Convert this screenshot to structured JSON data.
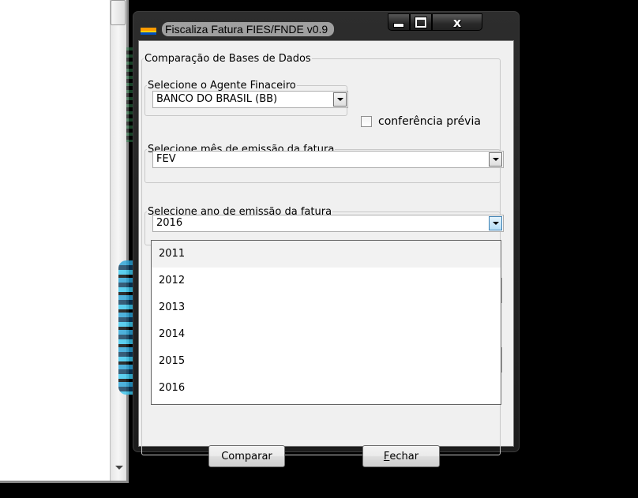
{
  "window": {
    "title": "Fiscaliza Fatura FIES/FNDE v0.9",
    "close_glyph": "x"
  },
  "group_comparacao": {
    "legend": "Comparação de Bases de Dados"
  },
  "agent": {
    "legend": "Selecione o Agente Finaceiro",
    "selected": "BANCO DO BRASIL (BB)"
  },
  "previa": {
    "label": "conferência prévia",
    "checked": false
  },
  "month": {
    "legend": "Selecione mês de emissão da fatura",
    "selected": "FEV"
  },
  "year": {
    "legend": "Selecione ano de emissão da fatura",
    "selected": "2016",
    "options": [
      "2011",
      "2012",
      "2013",
      "2014",
      "2015",
      "2016"
    ],
    "highlighted_option": "2011"
  },
  "buttons": {
    "compare": "Comparar",
    "close_mnemonic": "F",
    "close_rest": "echar"
  },
  "icons": {
    "app": "fies-app-icon",
    "dropdown": "chevron-down-icon"
  }
}
